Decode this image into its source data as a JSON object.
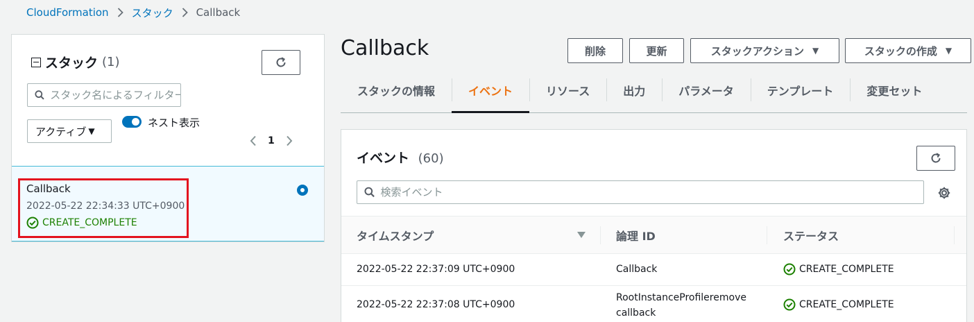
{
  "breadcrumb": {
    "items": [
      "CloudFormation",
      "スタック",
      "Callback"
    ]
  },
  "stacks_panel": {
    "title": "スタック",
    "count": "(1)",
    "search_placeholder": "スタック名によるフィルター",
    "filter": {
      "selected": "アクティブ"
    },
    "nested_toggle": {
      "label": "ネスト表示",
      "on": true
    },
    "page": "1",
    "stack": {
      "name": "Callback",
      "created": "2022-05-22 22:34:33 UTC+0900",
      "status": "CREATE_COMPLETE",
      "selected": true
    }
  },
  "page_title": "Callback",
  "actions": {
    "delete_label": "削除",
    "update_label": "更新",
    "stack_actions_label": "スタックアクション",
    "create_stack_label": "スタックの作成"
  },
  "tabs": [
    {
      "label": "スタックの情報",
      "active": false
    },
    {
      "label": "イベント",
      "active": true
    },
    {
      "label": "リソース",
      "active": false
    },
    {
      "label": "出力",
      "active": false
    },
    {
      "label": "パラメータ",
      "active": false
    },
    {
      "label": "テンプレート",
      "active": false
    },
    {
      "label": "変更セット",
      "active": false
    }
  ],
  "events": {
    "title": "イベント",
    "count": "(60)",
    "search_placeholder": "検索イベント",
    "columns": [
      "タイムスタンプ",
      "論理 ID",
      "ステータス"
    ],
    "rows": [
      {
        "timestamp": "2022-05-22 22:37:09 UTC+0900",
        "logical_id": [
          "Callback"
        ],
        "status": "CREATE_COMPLETE"
      },
      {
        "timestamp": "2022-05-22 22:37:08 UTC+0900",
        "logical_id": [
          "RootInstanceProfileremove",
          "callback"
        ],
        "status": "CREATE_COMPLETE"
      }
    ]
  },
  "colors": {
    "link": "#0073bb",
    "active_tab": "#ec7211",
    "success": "#1d8102",
    "highlight": "#e3141f",
    "selected_bg": "#f1faff"
  },
  "icons": {
    "refresh": "refresh-icon",
    "search": "search-icon",
    "settings": "gear-icon",
    "success": "check-circle-icon",
    "caret": "caret-down-icon",
    "chevron": "chevron-right-icon"
  }
}
